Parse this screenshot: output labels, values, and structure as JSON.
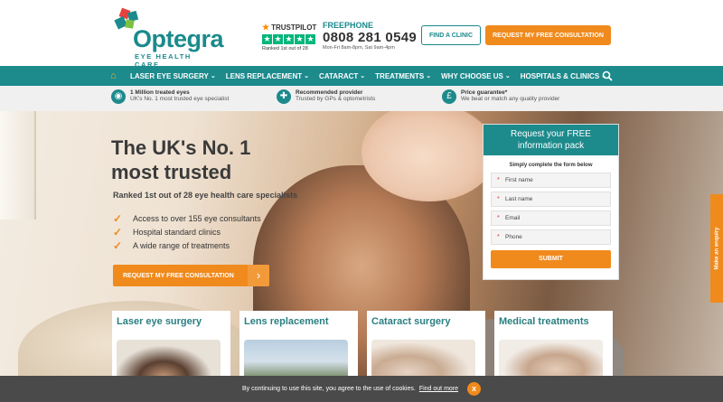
{
  "header": {
    "logo_word": "Optegra",
    "logo_sub": "EYE HEALTH CARE",
    "trustpilot": {
      "brand": "TRUSTPILOT",
      "rank": "Ranked 1st out of 28"
    },
    "phone": {
      "label": "FREEPHONE",
      "number": "0808 281 0549",
      "hours": "Mon-Fri 8am-8pm, Sat 9am-4pm"
    },
    "find_clinic": "FIND A CLINIC",
    "request_consult": "REQUEST MY FREE CONSULTATION"
  },
  "nav": {
    "items": [
      {
        "label": "LASER EYE SURGERY"
      },
      {
        "label": "LENS REPLACEMENT"
      },
      {
        "label": "CATARACT"
      },
      {
        "label": "TREATMENTS"
      },
      {
        "label": "WHY CHOOSE US"
      },
      {
        "label": "HOSPITALS & CLINICS"
      }
    ]
  },
  "usp": [
    {
      "title": "1 Million treated eyes",
      "sub": "UK's No. 1 most trusted eye specialist"
    },
    {
      "title": "Recommended provider",
      "sub": "Trusted by GPs & optometrists"
    },
    {
      "title": "Price guarantee*",
      "sub": "We beat or match any quality provider"
    }
  ],
  "hero": {
    "heading_line1": "The UK's No. 1",
    "heading_line2": "most trusted",
    "rank": "Ranked 1st out of 28 eye health care specialists",
    "bullets": [
      "Access to over 155 eye consultants",
      "Hospital standard clinics",
      "A wide range of treatments"
    ],
    "cta": "REQUEST MY FREE CONSULTATION"
  },
  "form": {
    "title_line1": "Request your FREE",
    "title_line2": "information pack",
    "intro": "Simply complete the form below",
    "fields": {
      "first_name": "First name",
      "last_name": "Last name",
      "email": "Email",
      "phone": "Phone"
    },
    "submit": "SUBMIT"
  },
  "enquiry": "Make an enquiry",
  "cards": [
    {
      "title": "Laser eye surgery"
    },
    {
      "title": "Lens replacement"
    },
    {
      "title": "Cataract surgery"
    },
    {
      "title": "Medical treatments"
    }
  ],
  "cookie": {
    "text": "By continuing to use this site, you agree to the use of cookies.",
    "link": "Find out more",
    "close": "x"
  },
  "colors": {
    "teal": "#1d8a8c",
    "orange": "#f08a1c",
    "trustpilot_green": "#00b67a"
  }
}
